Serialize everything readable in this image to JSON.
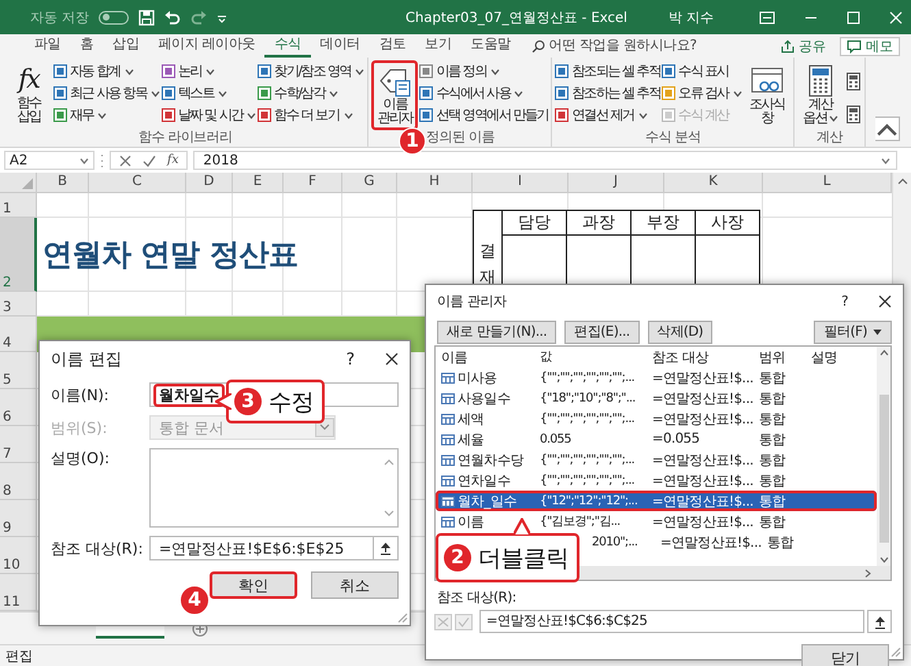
{
  "title_bar": {
    "autosave_label": "자동 저장",
    "autosave_on": false,
    "document_title": "Chapter03_07_연월정산표 - Excel",
    "user": "박 지수"
  },
  "ribbon_tabs": [
    {
      "label": "파일",
      "selected": false
    },
    {
      "label": "홈",
      "selected": false
    },
    {
      "label": "삽입",
      "selected": false
    },
    {
      "label": "페이지 레이아웃",
      "selected": false
    },
    {
      "label": "수식",
      "selected": true
    },
    {
      "label": "데이터",
      "selected": false
    },
    {
      "label": "검토",
      "selected": false
    },
    {
      "label": "보기",
      "selected": false
    },
    {
      "label": "도움말",
      "selected": false
    }
  ],
  "tell_me": {
    "placeholder": "어떤 작업을 원하시나요?"
  },
  "share_button": "공유",
  "memo_button": "메모",
  "ribbon_groups": [
    {
      "label": "함수 라이브러리",
      "parts": [
        {
          "kind": "large",
          "label": "함수 삽입",
          "glyph": "fx",
          "dropdown": false,
          "highlighted": false
        },
        {
          "kind": "column",
          "items": [
            {
              "kind": "labeled",
              "label": "자동 합계",
              "dropdown": true,
              "disabled": false
            },
            {
              "kind": "labeled",
              "label": "최근 사용 항목",
              "dropdown": true,
              "disabled": false
            },
            {
              "kind": "labeled",
              "label": "재무",
              "dropdown": true,
              "disabled": false
            }
          ]
        },
        {
          "kind": "column",
          "items": [
            {
              "kind": "labeled",
              "label": "논리",
              "dropdown": true,
              "disabled": false
            },
            {
              "kind": "labeled",
              "label": "텍스트",
              "dropdown": true,
              "disabled": false
            },
            {
              "kind": "labeled",
              "label": "날짜 및 시간",
              "dropdown": true,
              "disabled": false
            }
          ]
        },
        {
          "kind": "column",
          "items": [
            {
              "kind": "labeled",
              "label": "찾기/참조 영역",
              "dropdown": true,
              "disabled": false
            },
            {
              "kind": "labeled",
              "label": "수학/삼각",
              "dropdown": true,
              "disabled": false
            },
            {
              "kind": "labeled",
              "label": "함수 더 보기",
              "dropdown": true,
              "disabled": false
            }
          ]
        }
      ]
    },
    {
      "label": "정의된 이름",
      "parts": [
        {
          "kind": "large",
          "label": "이름 관리자",
          "dropdown": false,
          "highlighted": true
        },
        {
          "kind": "column",
          "items": [
            {
              "kind": "labeled",
              "label": "이름 정의",
              "dropdown": true,
              "disabled": false
            },
            {
              "kind": "labeled",
              "label": "수식에서 사용",
              "dropdown": true,
              "disabled": false
            },
            {
              "kind": "labeled",
              "label": "선택 영역에서 만들기",
              "dropdown": false,
              "disabled": false
            }
          ]
        }
      ]
    },
    {
      "label": "수식 분석",
      "parts": [
        {
          "kind": "column",
          "items": [
            {
              "kind": "labeled",
              "label": "참조되는 셀 추적",
              "dropdown": false,
              "disabled": false
            },
            {
              "kind": "labeled",
              "label": "참조하는 셀 추적",
              "dropdown": false,
              "disabled": false
            },
            {
              "kind": "labeled",
              "label": "연결선 제거",
              "dropdown": true,
              "disabled": false
            }
          ]
        },
        {
          "kind": "column",
          "items": [
            {
              "kind": "labeled",
              "label": "수식 표시",
              "dropdown": false,
              "disabled": false
            },
            {
              "kind": "labeled",
              "label": "오류 검사",
              "dropdown": true,
              "disabled": false
            },
            {
              "kind": "labeled",
              "label": "수식 계산",
              "dropdown": false,
              "disabled": true
            }
          ]
        },
        {
          "kind": "large",
          "label": "조사식 창",
          "dropdown": false,
          "highlighted": false
        }
      ]
    },
    {
      "label": "계산",
      "parts": [
        {
          "kind": "large",
          "label": "계산 옵션",
          "dropdown": true,
          "highlighted": false
        },
        {
          "kind": "column",
          "items": [
            {
              "kind": "icon",
              "dropdown": false,
              "disabled": false
            },
            {
              "kind": "icon",
              "dropdown": false,
              "disabled": false
            }
          ]
        }
      ]
    }
  ],
  "formula_bar": {
    "name_box": "A2",
    "fx": "fx",
    "value": "2018"
  },
  "sheet": {
    "columns": [
      "B",
      "C",
      "D",
      "E",
      "F",
      "G",
      "H",
      "I",
      "J",
      "K",
      "L"
    ],
    "rows": [
      {
        "label": "1",
        "selected": false
      },
      {
        "label": "2",
        "selected": true
      },
      {
        "label": "3",
        "selected": false
      },
      {
        "label": "4",
        "selected": false
      },
      {
        "label": "5",
        "selected": false
      },
      {
        "label": "6",
        "selected": false
      },
      {
        "label": "7",
        "selected": false
      },
      {
        "label": "8",
        "selected": false
      },
      {
        "label": "9",
        "selected": false
      },
      {
        "label": "10",
        "selected": false
      },
      {
        "label": "11",
        "selected": false
      }
    ],
    "title": "연월차 연말 정산표",
    "approval": {
      "label": "결재",
      "roles": [
        "담당",
        "과장",
        "부장",
        "사장"
      ]
    }
  },
  "status_bar": {
    "mode": "편집"
  },
  "name_edit_dialog": {
    "title": "이름 편집",
    "help": "?",
    "fields": [
      {
        "kind": "text",
        "label": "이름(N):",
        "value": "월차일수",
        "disabled": false,
        "highlighted": true
      },
      {
        "kind": "select",
        "label": "범위(S):",
        "value": "통합 문서",
        "disabled": true,
        "highlighted": false
      },
      {
        "kind": "textarea",
        "label": "설명(O):",
        "disabled": false,
        "highlighted": false
      },
      {
        "kind": "ref",
        "label": "참조 대상(R):",
        "value": "=연말정산표!$E$6:$E$25",
        "disabled": false,
        "highlighted": false
      }
    ],
    "buttons": [
      {
        "label": "확인",
        "highlighted": true
      },
      {
        "label": "취소",
        "highlighted": false
      }
    ]
  },
  "name_manager": {
    "title": "이름 관리자",
    "help": "?",
    "buttons": [
      "새로 만들기(N)...",
      "편집(E)...",
      "삭제(D)"
    ],
    "filter_button": "필터(F)",
    "columns": [
      "이름",
      "값",
      "참조 대상",
      "범위",
      "설명"
    ],
    "rows": [
      {
        "name": "미사용",
        "value": "{\"\";\"\";\"\";\"\";\"\";\"\";...",
        "refers_to": "=연말정산표!$...",
        "scope": "통합",
        "selected": false,
        "highlighted": false
      },
      {
        "name": "사용일수",
        "value": "{\"18\";\"10\";\"8\";\"...",
        "refers_to": "=연말정산표!$...",
        "scope": "통합",
        "selected": false,
        "highlighted": false
      },
      {
        "name": "세액",
        "value": "{\"\";\"\";\"\";\"\";\"\";\"\";...",
        "refers_to": "=연말정산표!$...",
        "scope": "통합",
        "selected": false,
        "highlighted": false
      },
      {
        "name": "세율",
        "value": "0.055",
        "refers_to": "=0.055",
        "scope": "통합",
        "selected": false,
        "highlighted": false
      },
      {
        "name": "연월차수당",
        "value": "{\"\";\"\";\"\";\"\";\"\";\"\";...",
        "refers_to": "=연말정산표!$...",
        "scope": "통합",
        "selected": false,
        "highlighted": false
      },
      {
        "name": "연차일수",
        "value": "{\"\";\"\";\"\";\"\";\"\";\"\";...",
        "refers_to": "=연말정산표!$...",
        "scope": "통합",
        "selected": false,
        "highlighted": false
      },
      {
        "name": "월차_일수",
        "value": "{\"12\";\"12\";\"12\";...",
        "refers_to": "=연말정산표!$...",
        "scope": "통합",
        "selected": true,
        "highlighted": true
      },
      {
        "name": "이름",
        "value": "{\"김보경\";\"김...",
        "refers_to": "=연말정산표!$...",
        "scope": "통합",
        "selected": false,
        "highlighted": false
      },
      {
        "value": "2010\";...",
        "refers_to": "=연말정산표!$...",
        "scope": "통합",
        "selected": false,
        "highlighted": false
      }
    ],
    "refers_label": "참조 대상(R):",
    "refers_value": "=연말정산표!$C$6:$C$25",
    "close_button": "닫기"
  },
  "annotations": [
    {
      "number": "1"
    },
    {
      "number": "3",
      "text": "수정"
    },
    {
      "number": "2",
      "text": "더블클릭"
    },
    {
      "number": "4"
    }
  ]
}
